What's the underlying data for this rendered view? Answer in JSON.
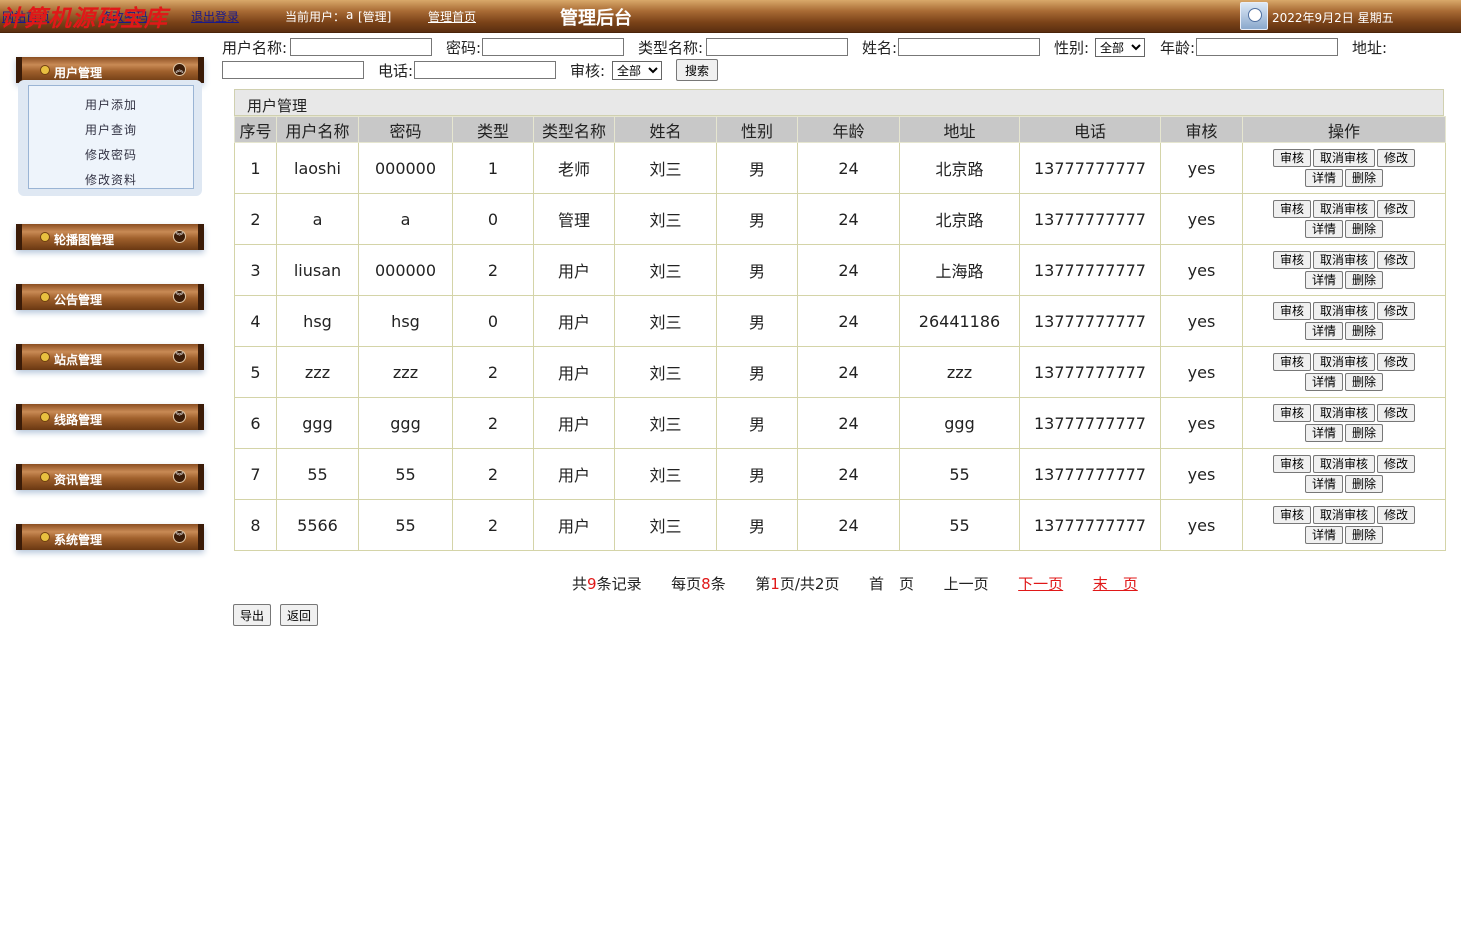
{
  "topbar": {
    "watermark": "计算机源码宝库",
    "link_home": "网站首页",
    "link_pw": "修改密码",
    "link_logout": "退出登录",
    "current_user_label": "当前用户：",
    "current_user": "a",
    "current_role": "[管理]",
    "admin_home_link": "管理首页",
    "system_title": "管理后台",
    "date": "2022年9月2日 星期五"
  },
  "sidebar": {
    "menus": [
      {
        "title": "用户管理",
        "items": [
          "用户添加",
          "用户查询",
          "修改密码",
          "修改资料"
        ]
      },
      {
        "title": "轮播图管理"
      },
      {
        "title": "公告管理"
      },
      {
        "title": "站点管理"
      },
      {
        "title": "线路管理"
      },
      {
        "title": "资讯管理"
      },
      {
        "title": "系统管理"
      }
    ]
  },
  "search": {
    "username_label": "用户名称:",
    "password_label": "密码:",
    "typename_label": "类型名称:",
    "name_label": "姓名:",
    "gender_label": "性别:",
    "gender_value": "全部",
    "age_label": "年龄:",
    "address_label": "地址:",
    "phone_label": "电话:",
    "audit_label": "审核:",
    "audit_value": "全部",
    "search_button": "搜索"
  },
  "table": {
    "title": "用户管理",
    "columns": [
      "序号",
      "用户名称",
      "密码",
      "类型",
      "类型名称",
      "姓名",
      "性别",
      "年龄",
      "地址",
      "电话",
      "审核",
      "操作"
    ],
    "rows": [
      [
        "1",
        "laoshi",
        "000000",
        "1",
        "老师",
        "刘三",
        "男",
        "24",
        "北京路",
        "13777777777",
        "yes"
      ],
      [
        "2",
        "a",
        "a",
        "0",
        "管理",
        "刘三",
        "男",
        "24",
        "北京路",
        "13777777777",
        "yes"
      ],
      [
        "3",
        "liusan",
        "000000",
        "2",
        "用户",
        "刘三",
        "男",
        "24",
        "上海路",
        "13777777777",
        "yes"
      ],
      [
        "4",
        "hsg",
        "hsg",
        "0",
        "用户",
        "刘三",
        "男",
        "24",
        "26441186",
        "13777777777",
        "yes"
      ],
      [
        "5",
        "zzz",
        "zzz",
        "2",
        "用户",
        "刘三",
        "男",
        "24",
        "zzz",
        "13777777777",
        "yes"
      ],
      [
        "6",
        "ggg",
        "ggg",
        "2",
        "用户",
        "刘三",
        "男",
        "24",
        "ggg",
        "13777777777",
        "yes"
      ],
      [
        "7",
        "55",
        "55",
        "2",
        "用户",
        "刘三",
        "男",
        "24",
        "55",
        "13777777777",
        "yes"
      ],
      [
        "8",
        "5566",
        "55",
        "2",
        "用户",
        "刘三",
        "男",
        "24",
        "55",
        "13777777777",
        "yes"
      ]
    ],
    "ops": {
      "audit": "审核",
      "cancel_audit": "取消审核",
      "edit": "修改",
      "detail": "详情",
      "delete": "删除"
    }
  },
  "pager": {
    "total_pre": "共",
    "total": "9",
    "total_post": "条记录",
    "per_pre": "每页",
    "per": "8",
    "per_post": "条",
    "page_pre": "第",
    "page": "1",
    "page_post": "页/共2页",
    "first": "首　页",
    "prev": "上一页",
    "next": "下一页",
    "last": "末　页"
  },
  "footer": {
    "export_button": "导出",
    "back_button": "返回"
  },
  "colors": {
    "topbar_brown": "#7a4218",
    "watermark_red": "#e01818",
    "link_red": "#e01818",
    "table_header_gray": "#c8c8c8"
  }
}
